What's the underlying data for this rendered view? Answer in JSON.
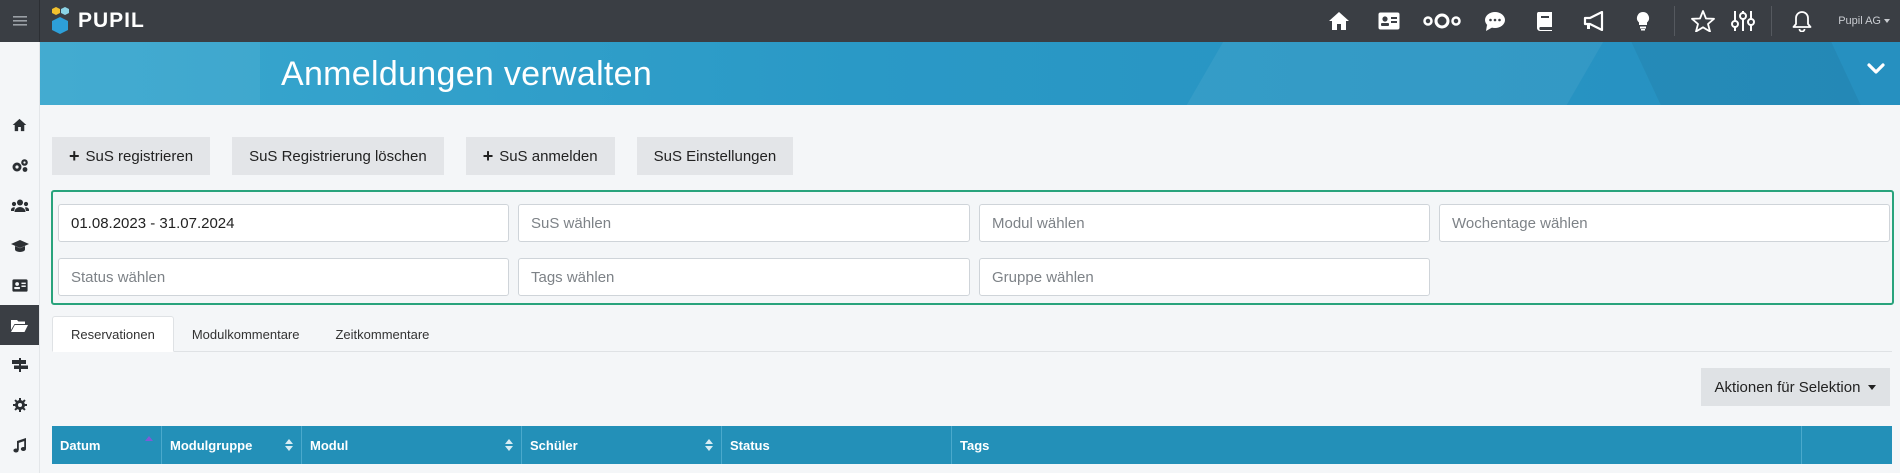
{
  "app": {
    "logo_text": "PUPIL",
    "user_label": "Pupil AG"
  },
  "page": {
    "title": "Anmeldungen verwalten"
  },
  "buttons": {
    "register": "SuS registrieren",
    "delete_registration": "SuS Registrierung löschen",
    "enroll": "SuS anmelden",
    "settings": "SuS Einstellungen"
  },
  "filters": {
    "date_range": "01.08.2023 - 31.07.2024",
    "students_placeholder": "SuS wählen",
    "module_placeholder": "Modul wählen",
    "weekdays_placeholder": "Wochentage wählen",
    "status_placeholder": "Status wählen",
    "tags_placeholder": "Tags wählen",
    "group_placeholder": "Gruppe wählen"
  },
  "tabs": [
    {
      "label": "Reservationen",
      "active": true
    },
    {
      "label": "Modulkommentare",
      "active": false
    },
    {
      "label": "Zeitkommentare",
      "active": false
    }
  ],
  "actions": {
    "label": "Aktionen für Selektion"
  },
  "table": {
    "columns": [
      "Datum",
      "Modulgruppe",
      "Modul",
      "Schüler",
      "Status",
      "Tags",
      ""
    ]
  },
  "colors": {
    "accent": "#2390b8",
    "filter_border": "#29a37c",
    "topbar": "#3a3e44"
  }
}
